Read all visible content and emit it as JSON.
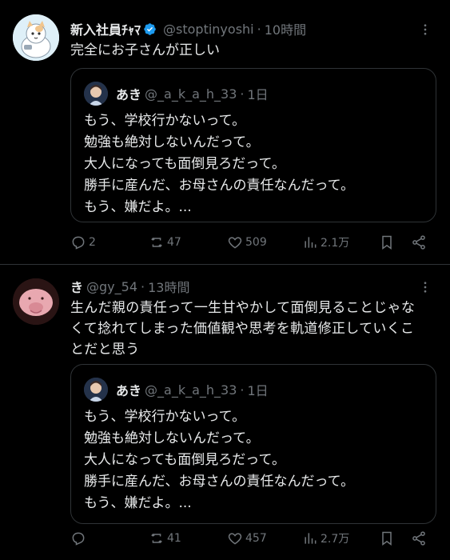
{
  "tweets": [
    {
      "name": "新入社員ﾁｬﾏ",
      "handle": "@stoptinyoshi",
      "separator": "·",
      "time": "10時間",
      "text": "完全にお子さんが正しい",
      "text_lines": [
        "完全にお子さんが正しい"
      ],
      "quote": {
        "name": "あき",
        "handle": "@_a_k_a_h_33",
        "separator": "·",
        "time": "1日",
        "lines": [
          "もう、学校行かないって。",
          "勉強も絶対しないんだって。",
          "大人になっても面倒見ろだって。",
          "勝手に産んだ、お母さんの責任なんだって。",
          "もう、嫌だよ。..."
        ]
      },
      "actions": {
        "replies": "2",
        "retweets": "47",
        "likes": "509",
        "views": "2.1万"
      },
      "verified": true
    },
    {
      "name": "き",
      "handle": "@gy_54",
      "separator": "·",
      "time": "13時間",
      "text_lines": [
        "生んだ親の責任って一生甘やかして面倒見ることじゃな",
        "くて捻れてしまった価値観や思考を軌道修正していくこ",
        "とだと思う"
      ],
      "quote": {
        "name": "あき",
        "handle": "@_a_k_a_h_33",
        "separator": "·",
        "time": "1日",
        "lines": [
          "もう、学校行かないって。",
          "勉強も絶対しないんだって。",
          "大人になっても面倒見ろだって。",
          "勝手に産んだ、お母さんの責任なんだって。",
          "もう、嫌だよ。..."
        ]
      },
      "actions": {
        "replies": "",
        "retweets": "41",
        "likes": "457",
        "views": "2.7万"
      },
      "verified": false
    }
  ],
  "colors": {
    "background": "#000000",
    "text": "#e7e9ea",
    "muted": "#71767b",
    "border": "#2f3336",
    "verified": "#1d9bf0"
  },
  "icons": [
    "more-icon",
    "verified-badge-icon",
    "reply-icon",
    "retweet-icon",
    "like-icon",
    "views-icon",
    "bookmark-icon",
    "share-icon"
  ]
}
